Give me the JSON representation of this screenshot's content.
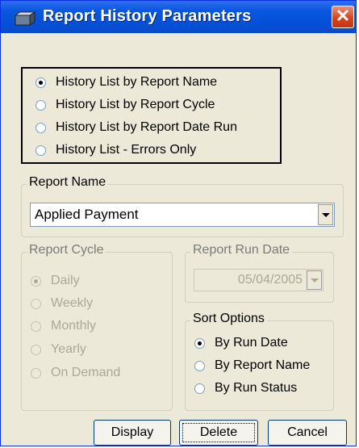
{
  "window": {
    "title": "Report History Parameters",
    "close_label": "✕"
  },
  "history_options": [
    {
      "label": "History List by Report Name",
      "checked": true
    },
    {
      "label": "History List by Report Cycle",
      "checked": false
    },
    {
      "label": "History List by Report Date Run",
      "checked": false
    },
    {
      "label": "History List - Errors Only",
      "checked": false
    }
  ],
  "report_name": {
    "legend": "Report Name",
    "value": "Applied Payment"
  },
  "report_cycle": {
    "legend": "Report Cycle",
    "options": [
      {
        "label": "Daily",
        "checked": true
      },
      {
        "label": "Weekly",
        "checked": false
      },
      {
        "label": "Monthly",
        "checked": false
      },
      {
        "label": "Yearly",
        "checked": false
      },
      {
        "label": "On Demand",
        "checked": false
      }
    ]
  },
  "report_run_date": {
    "legend": "Report Run Date",
    "value": "05/04/2005"
  },
  "sort_options": {
    "legend": "Sort Options",
    "options": [
      {
        "label": "By Run Date",
        "checked": true
      },
      {
        "label": "By Report Name",
        "checked": false
      },
      {
        "label": "By Run Status",
        "checked": false
      }
    ]
  },
  "buttons": {
    "display": "Display",
    "delete": "Delete",
    "cancel": "Cancel"
  }
}
